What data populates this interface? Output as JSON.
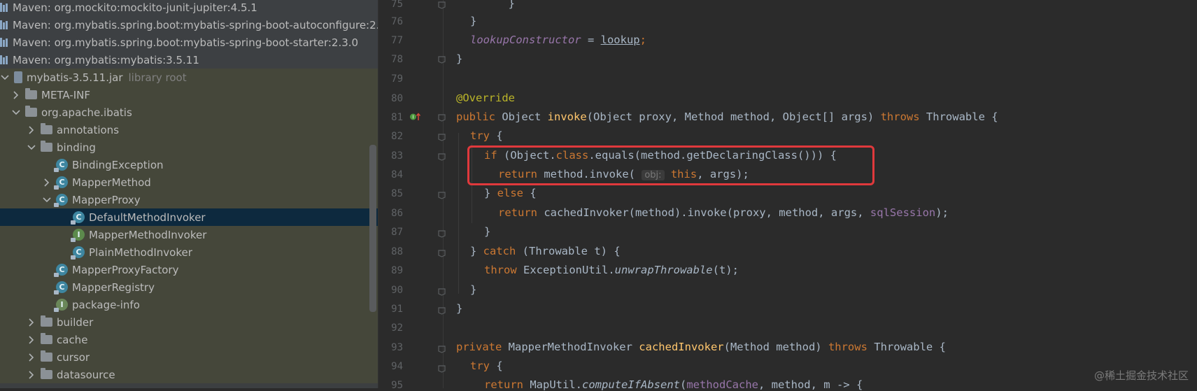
{
  "tree": {
    "rows": [
      {
        "label": "Maven: org.mockito:mockito-junit-jupiter:4.5.1"
      },
      {
        "label": "Maven: org.mybatis.spring.boot:mybatis-spring-boot-autoconfigure:2.3"
      },
      {
        "label": "Maven: org.mybatis.spring.boot:mybatis-spring-boot-starter:2.3.0"
      },
      {
        "label": "Maven: org.mybatis:mybatis:3.5.11"
      },
      {
        "label": "mybatis-3.5.11.jar",
        "suffix": "library root"
      },
      {
        "label": "META-INF"
      },
      {
        "label": "org.apache.ibatis"
      },
      {
        "label": "annotations"
      },
      {
        "label": "binding"
      },
      {
        "label": "BindingException"
      },
      {
        "label": "MapperMethod"
      },
      {
        "label": "MapperProxy"
      },
      {
        "label": "DefaultMethodInvoker"
      },
      {
        "label": "MapperMethodInvoker"
      },
      {
        "label": "PlainMethodInvoker"
      },
      {
        "label": "MapperProxyFactory"
      },
      {
        "label": "MapperRegistry"
      },
      {
        "label": "package-info"
      },
      {
        "label": "builder"
      },
      {
        "label": "cache"
      },
      {
        "label": "cursor"
      },
      {
        "label": "datasource"
      }
    ]
  },
  "editor": {
    "lines": [
      {
        "num": "75"
      },
      {
        "num": "76"
      },
      {
        "num": "77"
      },
      {
        "num": "78"
      },
      {
        "num": "79"
      },
      {
        "num": "80"
      },
      {
        "num": "81"
      },
      {
        "num": "82"
      },
      {
        "num": "83"
      },
      {
        "num": "84"
      },
      {
        "num": "85"
      },
      {
        "num": "86"
      },
      {
        "num": "87"
      },
      {
        "num": "88"
      },
      {
        "num": "89"
      },
      {
        "num": "90"
      },
      {
        "num": "91"
      },
      {
        "num": "92"
      },
      {
        "num": "93"
      },
      {
        "num": "94"
      },
      {
        "num": "95"
      }
    ],
    "tokens": {
      "l76": "}",
      "l77_field": "lookupConstructor",
      "l77_eq": " = ",
      "l77_val": "lookup",
      "l77_end": ";",
      "l78": "}",
      "l80": "@Override",
      "l81_public": "public",
      "l81_type": " Object ",
      "l81_name": "invoke",
      "l81_params": "(Object proxy, Method method, Object[] args) ",
      "l81_throws": "throws",
      "l81_tail": " Throwable {",
      "l82_try": "try",
      "l82_brace": " {",
      "l83_if": "if",
      "l83_a": " (Object.",
      "l83_class": "class",
      "l83_b": ".equals(method.getDeclaringClass())) {",
      "l84_return": "return",
      "l84_a": " method.invoke( ",
      "l84_hint": "obj:",
      "l84_this": " this",
      "l84_b": ", args);",
      "l85_a": "} ",
      "l85_else": "else",
      "l85_b": " {",
      "l86_return": "return",
      "l86_a": " cachedInvoker(method).invoke(proxy, method, args, ",
      "l86_field": "sqlSession",
      "l86_b": ");",
      "l87": "}",
      "l88_a": "} ",
      "l88_catch": "catch",
      "l88_b": " (Throwable t) {",
      "l89_throw": "throw",
      "l89_a": " ExceptionUtil.",
      "l89_fn": "unwrapThrowable",
      "l89_b": "(t);",
      "l90": "}",
      "l91": "}",
      "l93_private": "private",
      "l93_a": " MapperMethodInvoker ",
      "l93_fn": "cachedInvoker",
      "l93_b": "(Method method) ",
      "l93_throws": "throws",
      "l93_c": " Throwable {",
      "l94_try": "try",
      "l94_b": " {",
      "l95_return": "return",
      "l95_a": " MapUtil.",
      "l95_fn": "computeIfAbsent",
      "l95_b": "(",
      "l95_field": "methodCache",
      "l95_c": ", method, m -> {"
    }
  },
  "watermark": "@稀土掘金技术社区",
  "colors": {
    "highlight_box": "#e0393c",
    "selection": "#0d293e"
  }
}
